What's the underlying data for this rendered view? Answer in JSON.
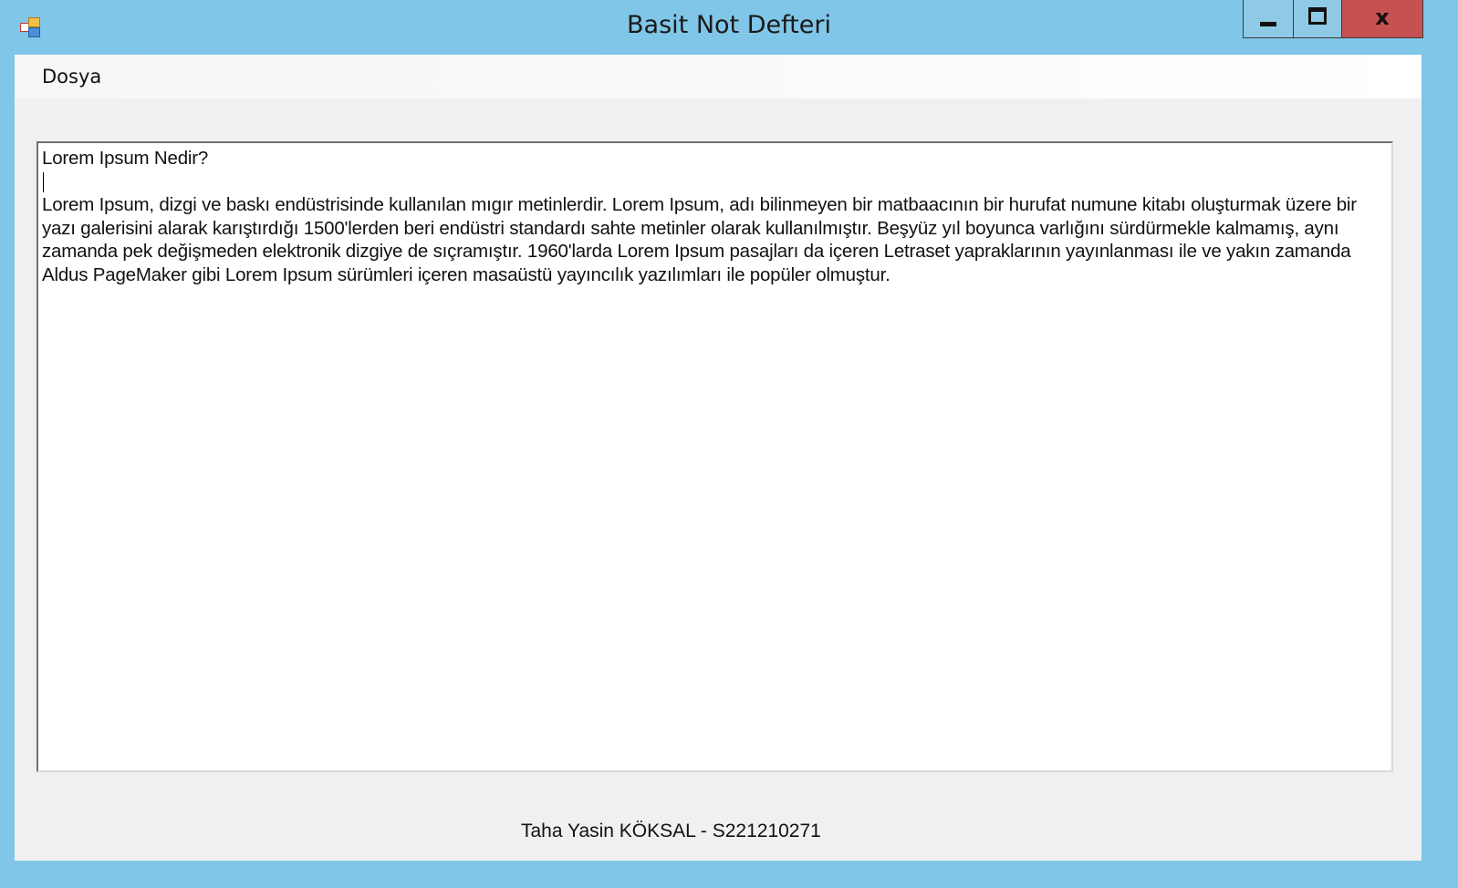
{
  "window": {
    "title": "Basit Not Defteri",
    "icon": "app-icon",
    "controls": {
      "minimize": "minimize-icon",
      "maximize": "maximize-icon",
      "close": "close-icon"
    },
    "close_glyph": "x"
  },
  "menubar": {
    "items": [
      {
        "label": "Dosya"
      }
    ]
  },
  "editor": {
    "heading_line": "Lorem Ipsum Nedir?",
    "body_line": "Lorem Ipsum, dizgi ve baskı endüstrisinde kullanılan mıgır metinlerdir. Lorem Ipsum, adı bilinmeyen bir matbaacının bir hurufat numune kitabı oluşturmak üzere bir yazı galerisini alarak karıştırdığı 1500'lerden beri endüstri standardı sahte metinler olarak kullanılmıştır. Beşyüz yıl boyunca varlığını sürdürmekle kalmamış, aynı zamanda pek değişmeden elektronik dizgiye de sıçramıştır. 1960'larda Lorem Ipsum pasajları da içeren Letraset yapraklarının yayınlanması ile ve yakın zamanda Aldus PageMaker gibi Lorem Ipsum sürümleri içeren masaüstü yayıncılık yazılımları ile popüler olmuştur."
  },
  "footer": {
    "label": "Taha Yasin KÖKSAL - S221210271"
  },
  "colors": {
    "title_bar": "#80c6e8",
    "close_button": "#c75050",
    "client_bg": "#f0f0f0"
  }
}
